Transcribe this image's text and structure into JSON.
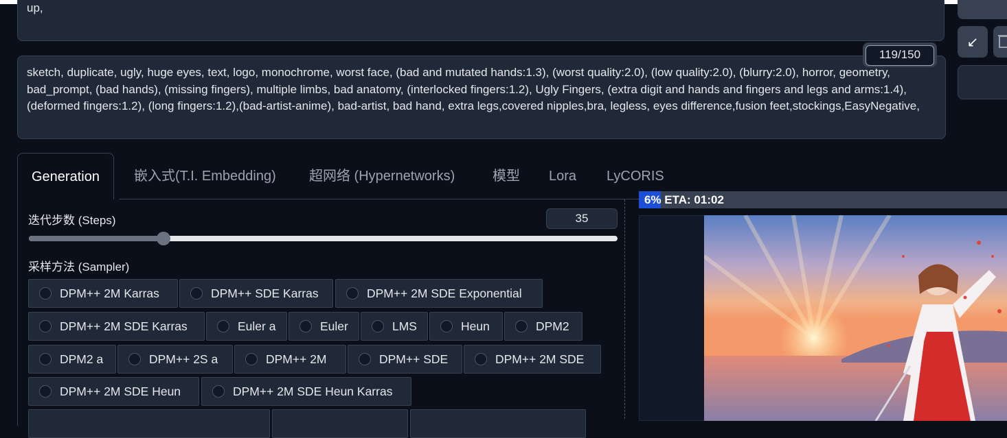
{
  "prompt": {
    "visible_text": "up,"
  },
  "negative_prompt": {
    "text": "sketch, duplicate, ugly, huge eyes, text, logo, monochrome, worst face, (bad and mutated hands:1.3), (worst quality:2.0), (low quality:2.0), (blurry:2.0), horror, geometry, bad_prompt, (bad hands), (missing fingers), multiple limbs, bad anatomy, (interlocked fingers:1.2), Ugly Fingers, (extra digit and hands and fingers and legs and arms:1.4), (deformed fingers:1.2), (long fingers:1.2),(bad-artist-anime), bad-artist, bad hand, extra legs,covered nipples,bra, legless, eyes difference,fusion feet,stockings,EasyNegative,",
    "token_counter": "119/150"
  },
  "side_buttons": {
    "arrow_icon": "↙"
  },
  "tabs": [
    {
      "label": "Generation",
      "active": true
    },
    {
      "label": "嵌入式(T.I. Embedding)"
    },
    {
      "label": "超网络 (Hypernetworks)"
    },
    {
      "label": "模型"
    },
    {
      "label": "Lora"
    },
    {
      "label": "LyCORIS"
    }
  ],
  "steps": {
    "label": "迭代步数 (Steps)",
    "value": "35",
    "value_num": 35,
    "min": 1,
    "max": 150
  },
  "sampler": {
    "label": "采样方法 (Sampler)",
    "options": [
      "DPM++ 2M Karras",
      "DPM++ SDE Karras",
      "DPM++ 2M SDE Exponential",
      "DPM++ 2M SDE Karras",
      "Euler a",
      "Euler",
      "LMS",
      "Heun",
      "DPM2",
      "DPM2 a",
      "DPM++ 2S a",
      "DPM++ 2M",
      "DPM++ SDE",
      "DPM++ 2M SDE",
      "DPM++ 2M SDE Heun",
      "DPM++ 2M SDE Heun Karras"
    ]
  },
  "progress": {
    "text": "6% ETA: 01:02",
    "fraction": 0.06
  },
  "colors": {
    "background": "#0b0f19",
    "panel": "#1f2937",
    "border": "#374151",
    "progress": "#1d4ed8"
  }
}
